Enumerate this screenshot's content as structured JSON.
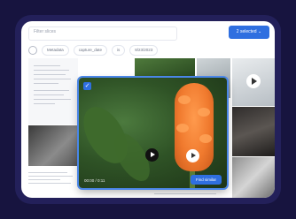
{
  "search": {
    "placeholder": "Filter slices"
  },
  "toolbar": {
    "selected_label": "2 selected"
  },
  "filters": [
    "Metadata",
    "capture_date",
    "is",
    "8/23/2023"
  ],
  "preview": {
    "timestamp": "00:00 / 0:11",
    "action_label": "Find similar"
  },
  "icons": [
    "filter-icon",
    "check-icon",
    "play-icon",
    "chevron-down-icon"
  ],
  "colors": {
    "accent": "#2f6fe0",
    "background": "#17143f",
    "frame": "#23205a"
  }
}
